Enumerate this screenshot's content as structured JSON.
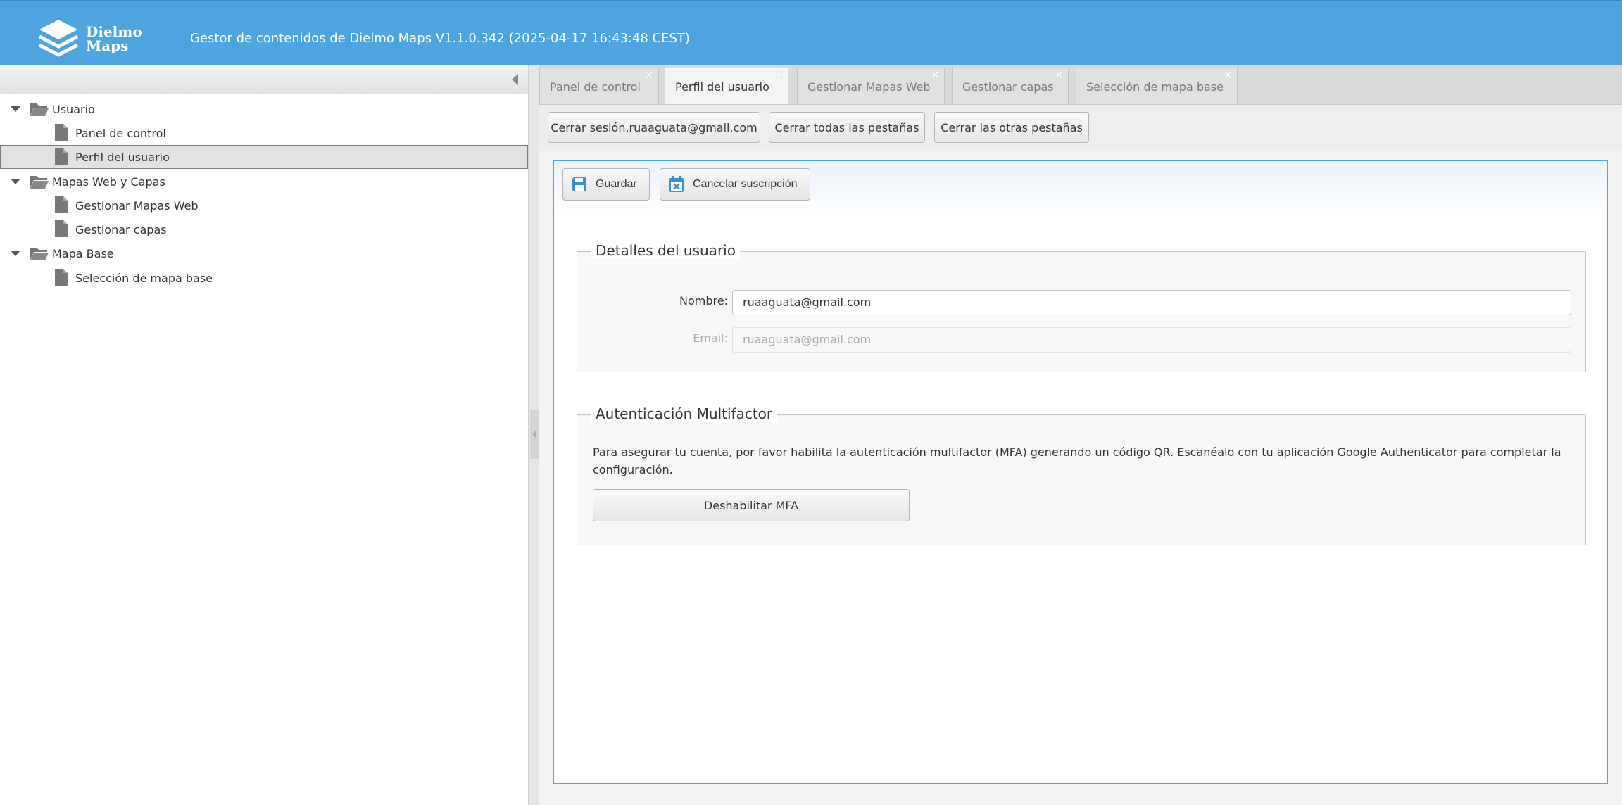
{
  "header": {
    "logo_line1": "Dielmo",
    "logo_line2": "Maps",
    "app_title": "Gestor de contenidos de Dielmo Maps V1.1.0.342 (2025-04-17 16:43:48 CEST)"
  },
  "tree": {
    "items": [
      {
        "label": "Usuario",
        "type": "folder"
      },
      {
        "label": "Panel de control",
        "type": "file"
      },
      {
        "label": "Perfil del usuario",
        "type": "file",
        "selected": true
      },
      {
        "label": "Mapas Web y Capas",
        "type": "folder"
      },
      {
        "label": "Gestionar Mapas Web",
        "type": "file"
      },
      {
        "label": "Gestionar capas",
        "type": "file"
      },
      {
        "label": "Mapa Base",
        "type": "folder"
      },
      {
        "label": "Selección de mapa base",
        "type": "file"
      }
    ]
  },
  "tabs": [
    {
      "label": "Panel de control",
      "close": "✕"
    },
    {
      "label": "Perfil del usuario",
      "close": "✕",
      "active": true
    },
    {
      "label": "Gestionar Mapas Web",
      "close": "✕"
    },
    {
      "label": "Gestionar capas",
      "close": "✕"
    },
    {
      "label": "Selección de mapa base",
      "close": "✕"
    }
  ],
  "toolbar": {
    "logout_label": "Cerrar sesión,ruaaguata@gmail.com",
    "close_all_label": "Cerrar todas las pestañas",
    "close_others_label": "Cerrar las otras pestañas"
  },
  "actions": {
    "save_label": "Guardar",
    "unsubscribe_label": "Cancelar suscripción"
  },
  "user_details": {
    "legend": "Detalles del usuario",
    "name_label": "Nombre:",
    "name_value": "ruaaguata@gmail.com",
    "email_label": "Email:",
    "email_value": "ruaaguata@gmail.com"
  },
  "mfa": {
    "legend": "Autenticación Multifactor",
    "description": "Para asegurar tu cuenta, por favor habilita la autenticación multifactor (MFA) generando un código QR. Escanéalo con tu aplicación Google Authenticator para completar la configuración.",
    "disable_label": "Deshabilitar MFA"
  },
  "colors": {
    "header_bg": "#4ea4de",
    "accent": "#4ea4de"
  }
}
